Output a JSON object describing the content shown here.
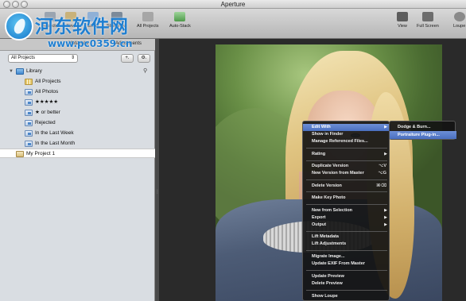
{
  "window": {
    "title": "Aperture"
  },
  "watermark": {
    "title": "河东软件网",
    "url": "www.pc0359.cn"
  },
  "toolbar": {
    "left_items": [
      "Inspector",
      "New",
      "Email",
      "Slideshow",
      "All Projects"
    ],
    "auto_stack": "Auto-Stack",
    "view": "View",
    "full_screen": "Full Screen",
    "loupe": "Loupe"
  },
  "tabs": {
    "metadata": "Metadata",
    "adjustments": "Adjustments"
  },
  "sidebar": {
    "project_select": "All Projects",
    "add_button": "+.",
    "gear_button": "⚙.",
    "library_label": "Library",
    "items": [
      "All Projects",
      "All Photos",
      "★★★★★",
      "★ or better",
      "Rejected",
      "In the Last Week",
      "In the Last Month"
    ],
    "project": "My Project 1"
  },
  "context_menu": {
    "items": [
      {
        "label": "Edit With",
        "submenu": true,
        "highlighted": true
      },
      {
        "label": "Show in Finder"
      },
      {
        "label": "Manage Referenced Files..."
      },
      {
        "label": "Rating",
        "submenu": true
      },
      {
        "label": "Duplicate Version",
        "shortcut": "⌥V"
      },
      {
        "label": "New Version from Master",
        "shortcut": "⌥G"
      },
      {
        "label": "Delete Version",
        "shortcut": "⌘⌫"
      },
      {
        "label": "Make Key Photo"
      },
      {
        "label": "New from Selection",
        "submenu": true
      },
      {
        "label": "Export",
        "submenu": true
      },
      {
        "label": "Output",
        "submenu": true
      },
      {
        "label": "Lift Metadata"
      },
      {
        "label": "Lift Adjustments"
      },
      {
        "label": "Migrate Image..."
      },
      {
        "label": "Update EXIF From Master"
      },
      {
        "label": "Update Preview"
      },
      {
        "label": "Delete Preview"
      },
      {
        "label": "Show Loupe"
      }
    ]
  },
  "submenu": {
    "items": [
      "Dodge & Burn...",
      "Portraiture Plug-in..."
    ]
  }
}
